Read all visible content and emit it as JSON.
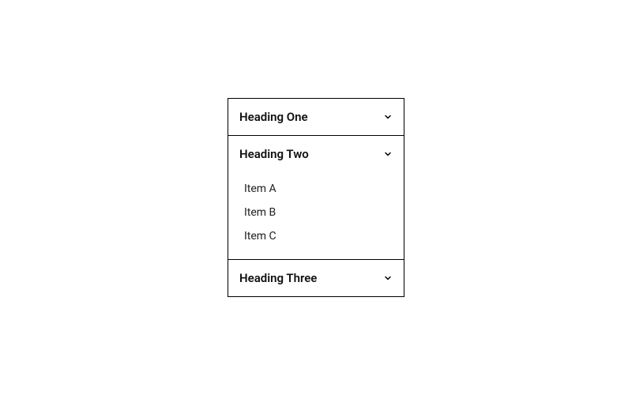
{
  "accordion": {
    "sections": [
      {
        "title": "Heading One"
      },
      {
        "title": "Heading Two",
        "items": [
          "Item A",
          "Item B",
          "Item C"
        ]
      },
      {
        "title": "Heading Three"
      }
    ]
  }
}
